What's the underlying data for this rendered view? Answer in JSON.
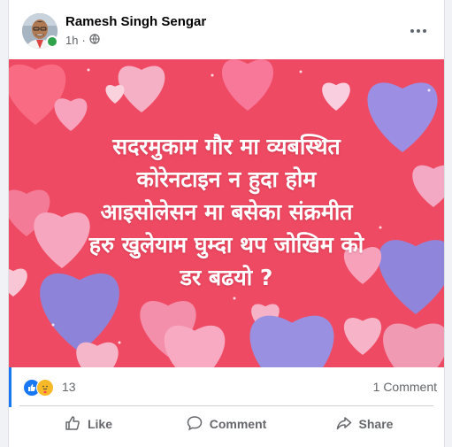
{
  "post": {
    "author": "Ramesh Singh Sengar",
    "time": "1h",
    "privacy_dot": "·",
    "privacy_icon": "globe-icon",
    "text_lines": [
      "सदरमुकाम गौर मा व्यबस्थित",
      "कोरेनटाइन न हुदा होम",
      "आइसोलेसन मा बसेका संक्रमीत",
      "हरु खुलेयाम घुम्दा थप जोखिम को",
      "डर बढयो ?"
    ]
  },
  "reactions": {
    "count": "13",
    "types": [
      "like-icon",
      "care-icon"
    ],
    "comments": "1 Comment"
  },
  "actions": {
    "like": "Like",
    "comment": "Comment",
    "share": "Share"
  },
  "colors": {
    "background_red": "#ef4a63",
    "heart_purple": "#8f86dc",
    "heart_pink": "#f59bb3",
    "accent_blue": "#1877f2"
  }
}
